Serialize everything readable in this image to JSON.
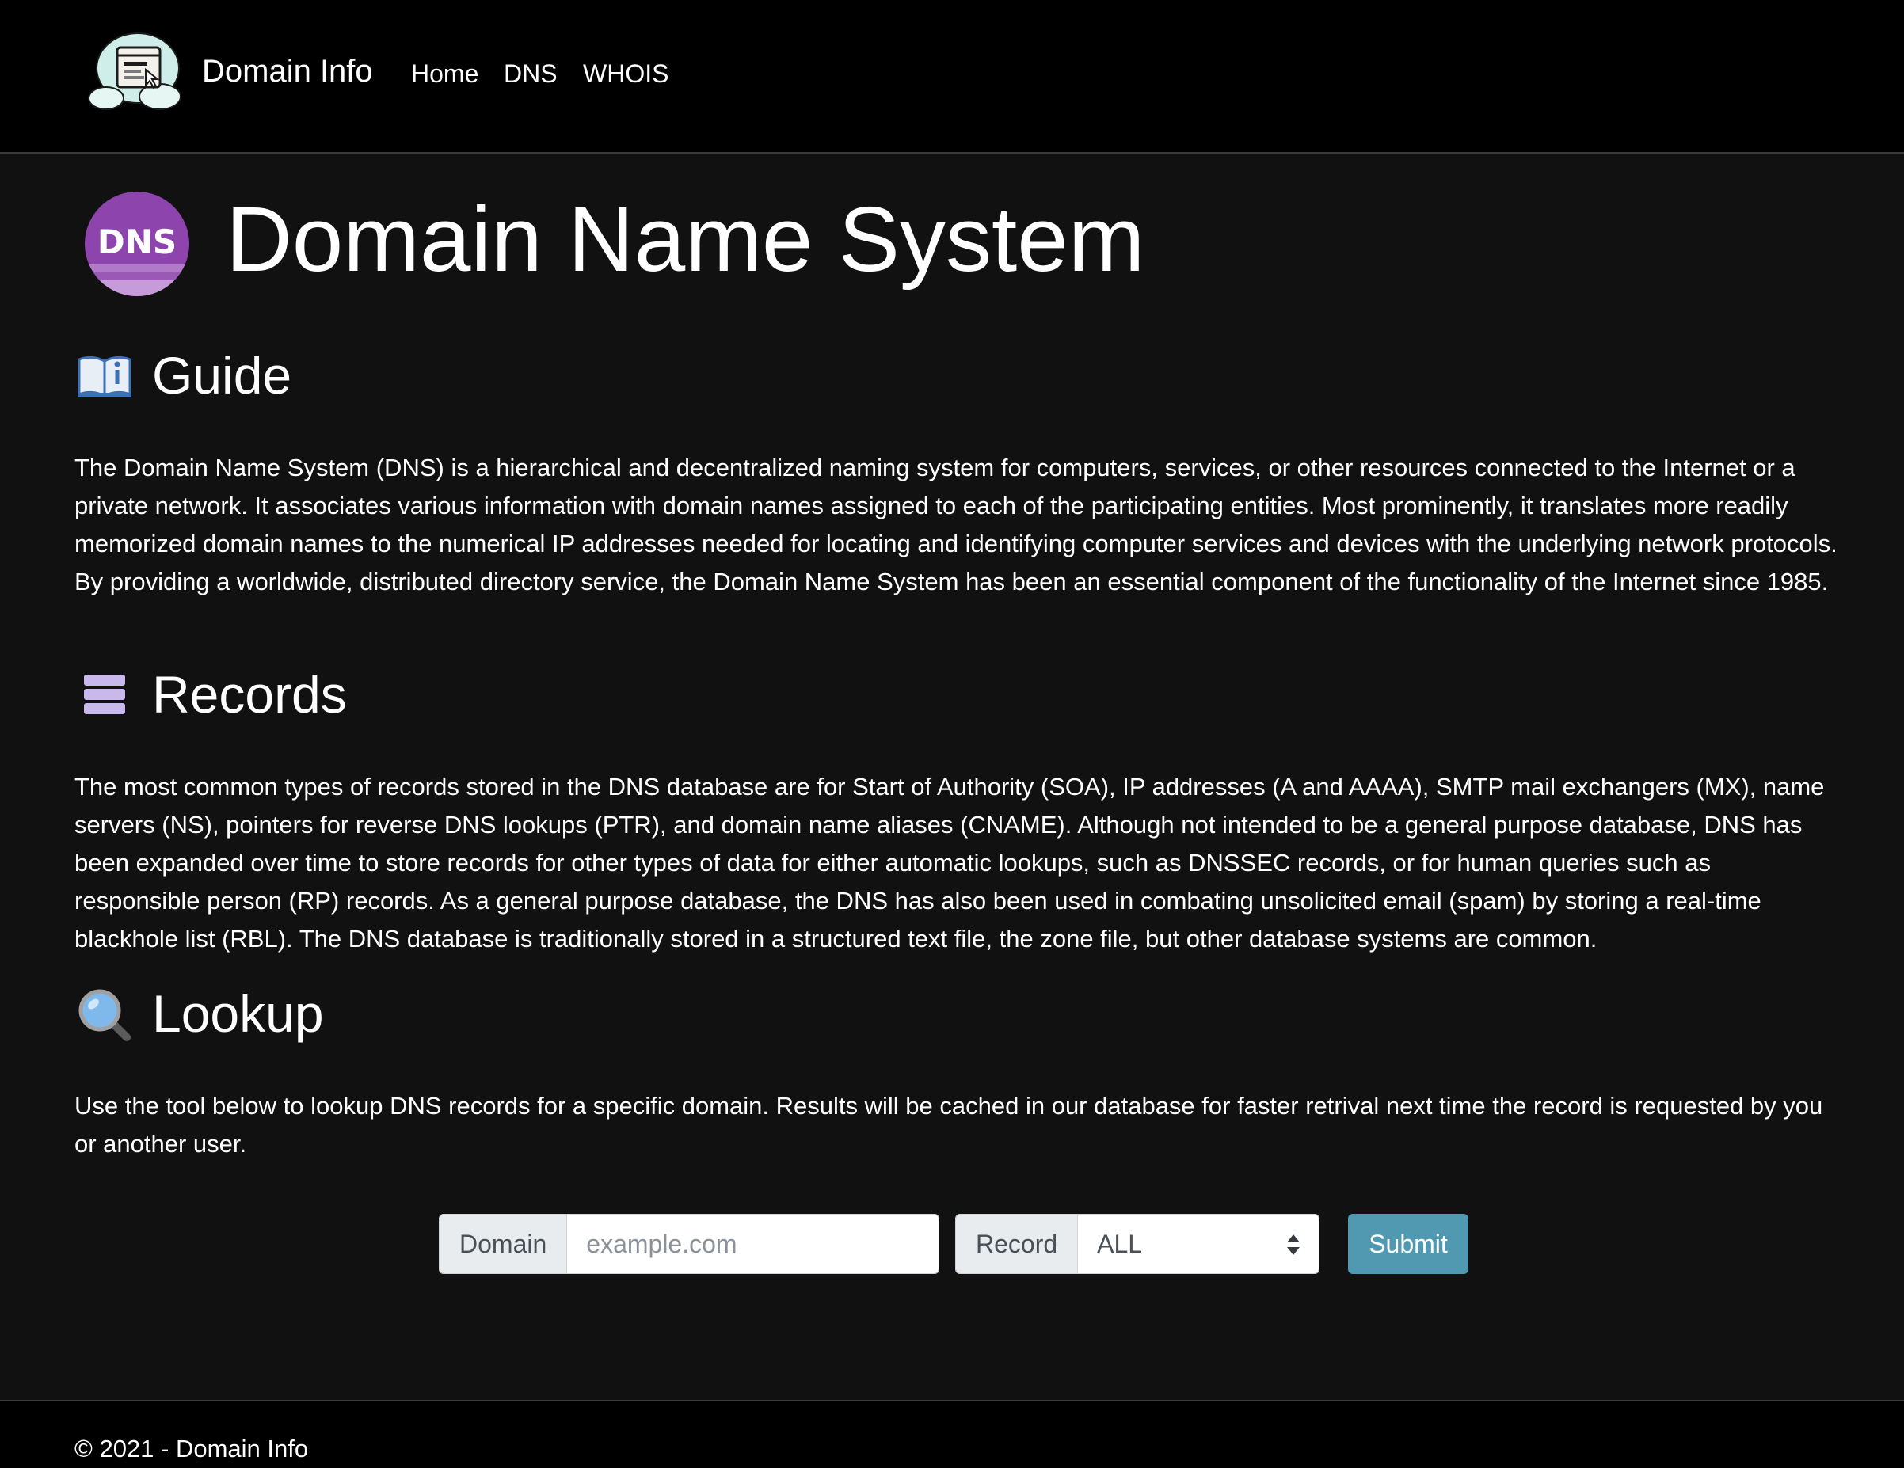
{
  "navbar": {
    "brand": "Domain Info",
    "links": [
      "Home",
      "DNS",
      "WHOIS"
    ]
  },
  "page": {
    "title": "Domain Name System",
    "title_icon_text": "DNS"
  },
  "sections": {
    "guide": {
      "heading": "Guide",
      "icon": "book-info-icon",
      "text": "The Domain Name System (DNS) is a hierarchical and decentralized naming system for computers, services, or other resources connected to the Internet or a private network. It associates various information with domain names assigned to each of the participating entities. Most prominently, it translates more readily memorized domain names to the numerical IP addresses needed for locating and identifying computer services and devices with the underlying network protocols. By providing a worldwide, distributed directory service, the Domain Name System has been an essential component of the functionality of the Internet since 1985."
    },
    "records": {
      "heading": "Records",
      "icon": "database-icon",
      "text": "The most common types of records stored in the DNS database are for Start of Authority (SOA), IP addresses (A and AAAA), SMTP mail exchangers (MX), name servers (NS), pointers for reverse DNS lookups (PTR), and domain name aliases (CNAME). Although not intended to be a general purpose database, DNS has been expanded over time to store records for other types of data for either automatic lookups, such as DNSSEC records, or for human queries such as responsible person (RP) records. As a general purpose database, the DNS has also been used in combating unsolicited email (spam) by storing a real-time blackhole list (RBL). The DNS database is traditionally stored in a structured text file, the zone file, but other database systems are common."
    },
    "lookup": {
      "heading": "Lookup",
      "icon": "magnifier-icon",
      "text": "Use the tool below to lookup DNS records for a specific domain. Results will be cached in our database for faster retrival next time the record is requested by you or another user."
    }
  },
  "form": {
    "domain_label": "Domain",
    "domain_placeholder": "example.com",
    "domain_value": "",
    "record_label": "Record",
    "record_selected": "ALL",
    "submit_label": "Submit"
  },
  "footer": {
    "text": "© 2021 - Domain Info"
  },
  "colors": {
    "page_background": "#111111",
    "navbar_background": "#000000",
    "submit_button": "#5199b1",
    "dns_badge": "#8e44ad"
  }
}
